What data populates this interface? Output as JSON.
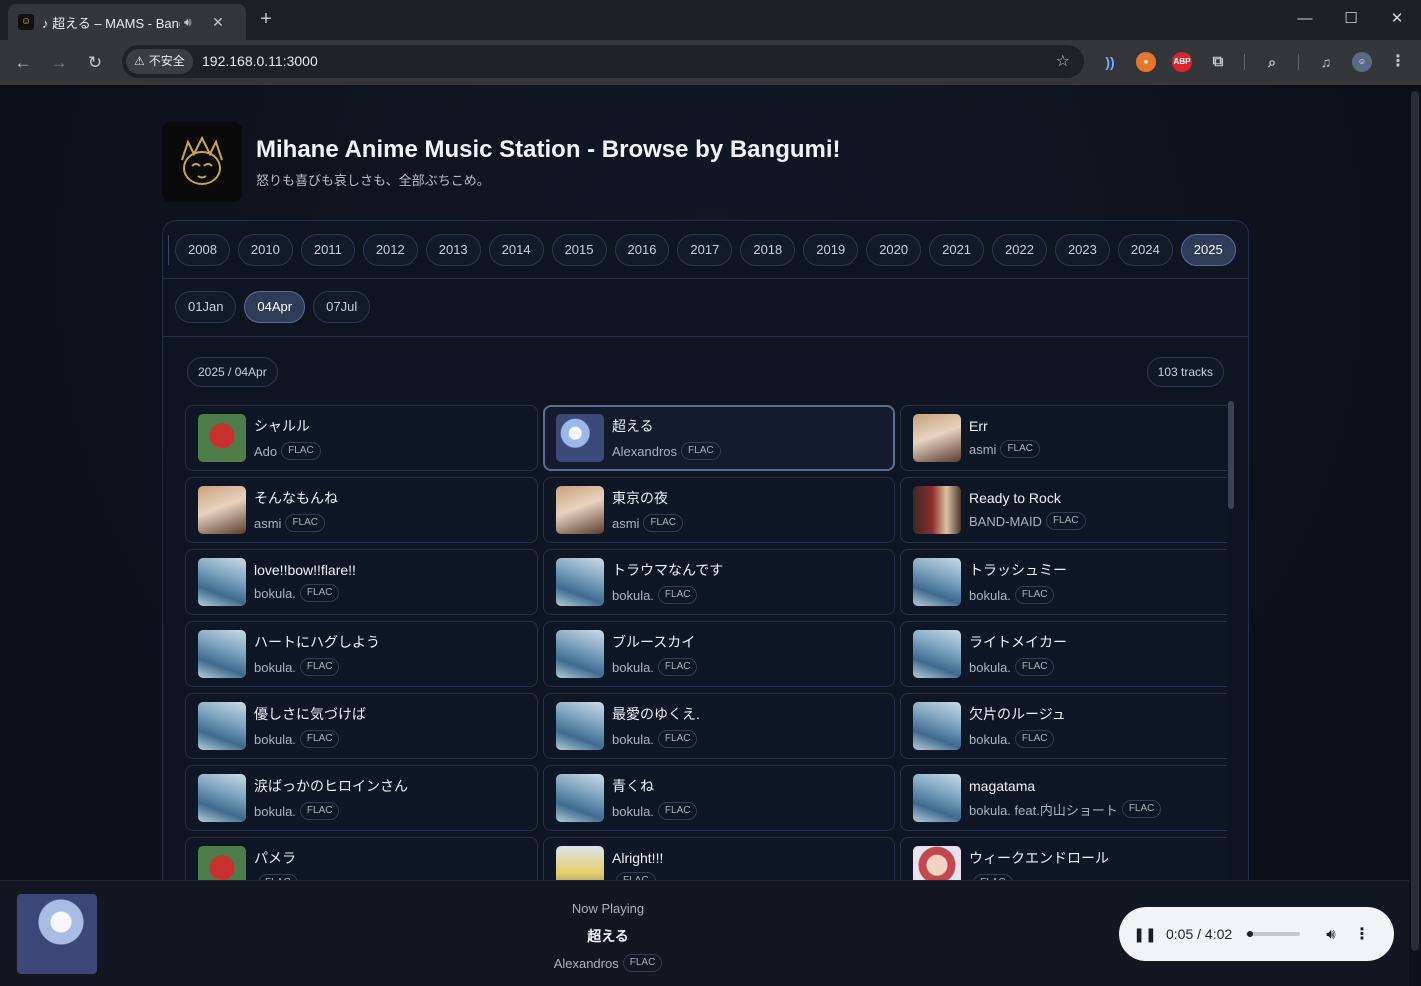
{
  "browser": {
    "tab_title": "♪ 超える – MAMS - Bangumi",
    "url": "192.168.0.11:3000",
    "insecure_label": "不安全",
    "ext_abp": "ABP"
  },
  "site": {
    "title": "Mihane Anime Music Station - Browse by Bangumi!",
    "subtitle": "怒りも喜びも哀しさも、全部ぶちこめ。"
  },
  "years": [
    "2008",
    "2010",
    "2011",
    "2012",
    "2013",
    "2014",
    "2015",
    "2016",
    "2017",
    "2018",
    "2019",
    "2020",
    "2021",
    "2022",
    "2023",
    "2024",
    "2025"
  ],
  "selected_year": "2025",
  "seasons": [
    "01Jan",
    "04Apr",
    "07Jul"
  ],
  "selected_season": "04Apr",
  "listing": {
    "breadcrumb": "2025 / 04Apr",
    "track_count": "103 tracks"
  },
  "tracks": [
    {
      "title": "シャルル",
      "artist": "Ado",
      "format": "FLAC",
      "cover": "c-red"
    },
    {
      "title": "超える",
      "artist": "Alexandros",
      "format": "FLAC",
      "cover": "c-blue",
      "active": true
    },
    {
      "title": "Err",
      "artist": "asmi",
      "format": "FLAC",
      "cover": "c-asmi"
    },
    {
      "title": "そんなもんね",
      "artist": "asmi",
      "format": "FLAC",
      "cover": "c-asmi"
    },
    {
      "title": "東京の夜",
      "artist": "asmi",
      "format": "FLAC",
      "cover": "c-asmi"
    },
    {
      "title": "Ready to Rock",
      "artist": "BAND-MAID",
      "format": "FLAC",
      "cover": "c-band"
    },
    {
      "title": "love!!bow!!flare!!",
      "artist": "bokula.",
      "format": "FLAC",
      "cover": "c-bokula"
    },
    {
      "title": "トラウマなんです",
      "artist": "bokula.",
      "format": "FLAC",
      "cover": "c-bokula"
    },
    {
      "title": "トラッシュミー",
      "artist": "bokula.",
      "format": "FLAC",
      "cover": "c-bokula"
    },
    {
      "title": "ハートにハグしよう",
      "artist": "bokula.",
      "format": "FLAC",
      "cover": "c-bokula"
    },
    {
      "title": "ブルースカイ",
      "artist": "bokula.",
      "format": "FLAC",
      "cover": "c-bokula"
    },
    {
      "title": "ライトメイカー",
      "artist": "bokula.",
      "format": "FLAC",
      "cover": "c-bokula"
    },
    {
      "title": "優しさに気づけば",
      "artist": "bokula.",
      "format": "FLAC",
      "cover": "c-bokula"
    },
    {
      "title": "最愛のゆくえ.",
      "artist": "bokula.",
      "format": "FLAC",
      "cover": "c-bokula"
    },
    {
      "title": "欠片のルージュ",
      "artist": "bokula.",
      "format": "FLAC",
      "cover": "c-bokula"
    },
    {
      "title": "涙ばっかのヒロインさん",
      "artist": "bokula.",
      "format": "FLAC",
      "cover": "c-bokula"
    },
    {
      "title": "青くね",
      "artist": "bokula.",
      "format": "FLAC",
      "cover": "c-bokula"
    },
    {
      "title": "magatama",
      "artist": "bokula. feat.内山ショート",
      "format": "FLAC",
      "cover": "c-bokula"
    },
    {
      "title": "パメラ",
      "artist": "",
      "format": "FLAC",
      "cover": "c-red"
    },
    {
      "title": "Alright!!!",
      "artist": "",
      "format": "FLAC",
      "cover": "c-flow"
    },
    {
      "title": "ウィークエンドロール",
      "artist": "",
      "format": "FLAC",
      "cover": "c-week"
    }
  ],
  "now_playing": {
    "label": "Now Playing",
    "title": "超える",
    "artist": "Alexandros",
    "format": "FLAC",
    "time": "0:05 / 4:02",
    "progress": 0.02
  }
}
